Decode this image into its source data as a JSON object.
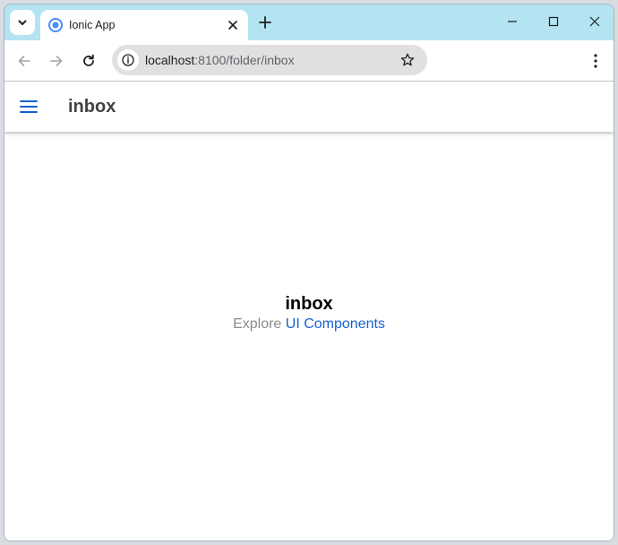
{
  "browser": {
    "tab_title": "Ionic App",
    "url_host": "localhost",
    "url_rest": ":8100/folder/inbox",
    "tabstrip_color": "#b4e3f1"
  },
  "app": {
    "header_title": "inbox",
    "container_title": "inbox",
    "explore_text": "Explore ",
    "link_text": "UI Components",
    "link_color": "#1561d3"
  },
  "icons": {
    "tab_search": "chevron-down-icon",
    "favicon": "chrome-favicon-icon",
    "tab_close": "close-icon",
    "new_tab": "plus-icon",
    "minimize": "minimize-icon",
    "maximize": "maximize-icon",
    "close_window": "close-icon",
    "back": "arrow-left-icon",
    "forward": "arrow-right-icon",
    "reload": "reload-icon",
    "site_info": "site-info-icon",
    "bookmark": "star-icon",
    "menu": "more-vert-icon",
    "hamburger": "menu-icon"
  }
}
